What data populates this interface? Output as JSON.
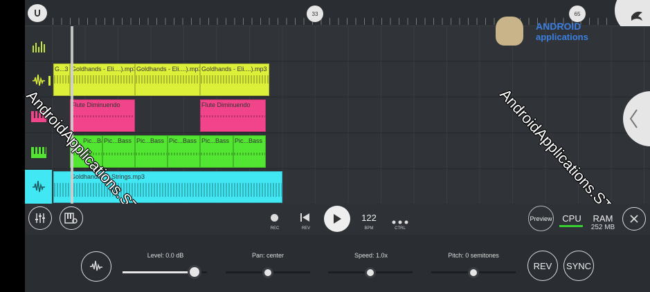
{
  "ruler": {
    "markers": [
      "33",
      "65"
    ]
  },
  "clips": {
    "row1": [
      "G...3",
      "Goldhands - Eli....).mp3",
      "Goldhands - Eli....).mp3",
      "Goldhands - Eli....).mp3"
    ],
    "row2": [
      "Flute Diminuendo",
      "Flute Diminuendo"
    ],
    "row3": [
      "Pic...Bass",
      "Pic...Bass",
      "Pic...Bass",
      "Pic...Bass",
      "Pic...Bass",
      "Pic...Bass"
    ],
    "row4": [
      "Goldhands - ...Strings.mp3"
    ]
  },
  "watermarks": [
    "AndroidApplications.STORE",
    "AndroidApplications.STORE"
  ],
  "logo": {
    "title": "ANDROID",
    "subtitle": "applications"
  },
  "transport": {
    "rec": "REC",
    "rev": "REV",
    "bpm_value": "122",
    "bpm_label": "BPM",
    "ctrl": "CTRL",
    "preview": "Preview",
    "cpu": "CPU",
    "ram": "RAM",
    "ram_value": "252 MB"
  },
  "bottom": {
    "level_label": "Level: 0.0 dB",
    "level_value": 0.85,
    "pan_label": "Pan: center",
    "pan_value": 0.5,
    "speed_label": "Speed: 1.0x",
    "speed_value": 0.5,
    "pitch_label": "Pitch: 0 semitones",
    "pitch_value": 0.5,
    "rev_button": "REV",
    "sync_button": "SYNC"
  },
  "colors": {
    "yellow": "#dcf03a",
    "pink": "#f2448a",
    "green": "#52e532",
    "cyan": "#41e8f4"
  }
}
